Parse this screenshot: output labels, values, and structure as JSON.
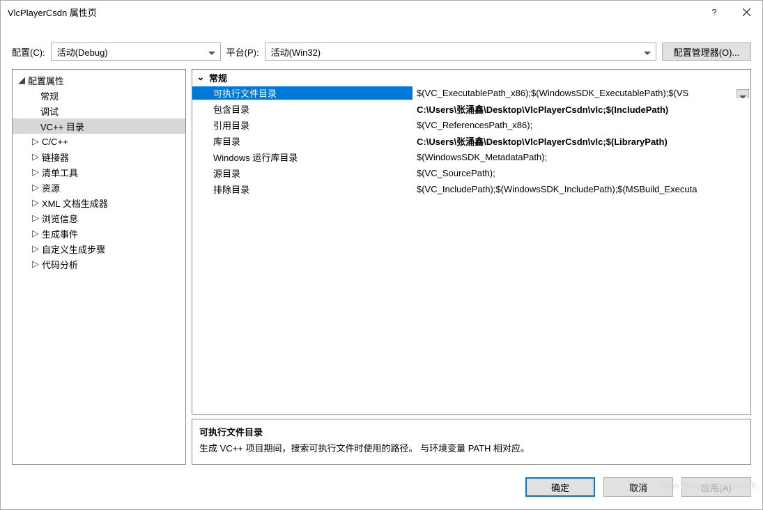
{
  "window": {
    "title": "VlcPlayerCsdn 属性页"
  },
  "toolbar": {
    "config_label": "配置(C):",
    "config_value": "活动(Debug)",
    "platform_label": "平台(P):",
    "platform_value": "活动(Win32)",
    "config_manager": "配置管理器(O)..."
  },
  "tree": {
    "root": "配置属性",
    "items": [
      {
        "label": "常规",
        "expander": ""
      },
      {
        "label": "调试",
        "expander": ""
      },
      {
        "label": "VC++ 目录",
        "expander": "",
        "selected": true
      },
      {
        "label": "C/C++",
        "expander": "▷"
      },
      {
        "label": "链接器",
        "expander": "▷"
      },
      {
        "label": "清单工具",
        "expander": "▷"
      },
      {
        "label": "资源",
        "expander": "▷"
      },
      {
        "label": "XML 文档生成器",
        "expander": "▷"
      },
      {
        "label": "浏览信息",
        "expander": "▷"
      },
      {
        "label": "生成事件",
        "expander": "▷"
      },
      {
        "label": "自定义生成步骤",
        "expander": "▷"
      },
      {
        "label": "代码分析",
        "expander": "▷"
      }
    ]
  },
  "grid": {
    "group": "常规",
    "rows": [
      {
        "key": "可执行文件目录",
        "val": "$(VC_ExecutablePath_x86);$(WindowsSDK_ExecutablePath);$(VS",
        "selected": true,
        "bold": false
      },
      {
        "key": "包含目录",
        "val": "C:\\Users\\张涌鑫\\Desktop\\VlcPlayerCsdn\\vlc;$(IncludePath)",
        "bold": true
      },
      {
        "key": "引用目录",
        "val": "$(VC_ReferencesPath_x86);",
        "bold": false
      },
      {
        "key": "库目录",
        "val": "C:\\Users\\张涌鑫\\Desktop\\VlcPlayerCsdn\\vlc;$(LibraryPath)",
        "bold": true
      },
      {
        "key": "Windows 运行库目录",
        "val": "$(WindowsSDK_MetadataPath);",
        "bold": false
      },
      {
        "key": "源目录",
        "val": "$(VC_SourcePath);",
        "bold": false
      },
      {
        "key": "排除目录",
        "val": "$(VC_IncludePath);$(WindowsSDK_IncludePath);$(MSBuild_Executa",
        "bold": false
      }
    ]
  },
  "description": {
    "title": "可执行文件目录",
    "body": "生成 VC++ 项目期间，搜索可执行文件时使用的路径。 与环境变量 PATH 相对应。"
  },
  "buttons": {
    "ok": "确定",
    "cancel": "取消",
    "apply": "应用(A)"
  },
  "watermark": "https://blog.csdn.net/Jonh"
}
